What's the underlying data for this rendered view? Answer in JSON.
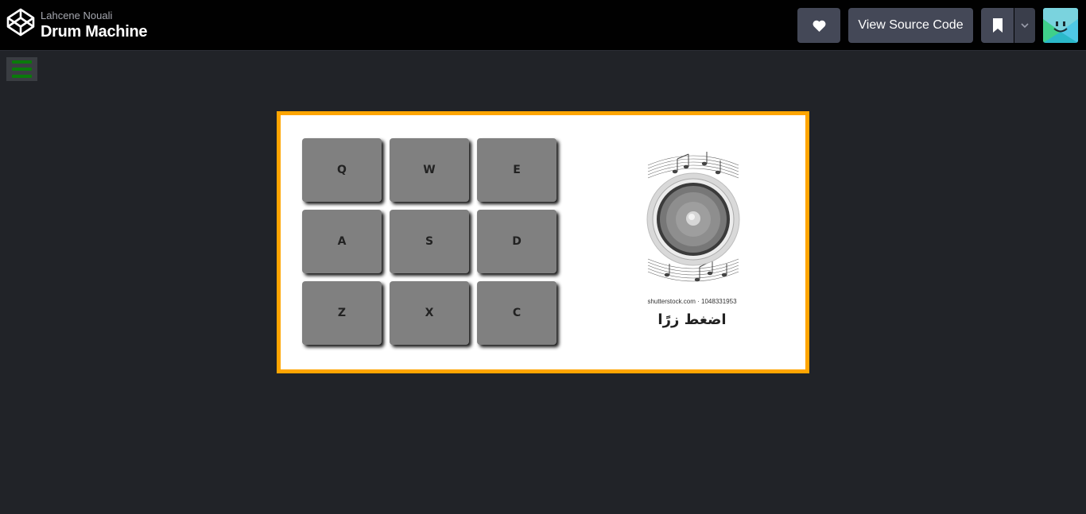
{
  "header": {
    "author": "Lahcene Nouali",
    "title": "Drum Machine",
    "source_label": "View Source Code",
    "logo_icon": "codepen-logo-icon",
    "heart_icon": "heart-icon",
    "bookmark_icon": "bookmark-icon",
    "caret_icon": "chevron-down-icon",
    "avatar_icon": "avatar-smiley"
  },
  "menu": {
    "icon": "hamburger-icon"
  },
  "drum": {
    "pads": [
      "Q",
      "W",
      "E",
      "A",
      "S",
      "D",
      "Z",
      "X",
      "C"
    ],
    "image_credit": "shutterstock.com · 1048331953",
    "display_text": "اضغط زرًا"
  },
  "colors": {
    "page_bg": "#212328",
    "header_bg": "#010101",
    "button_bg": "#444857",
    "machine_border": "#ffa500",
    "pad": "#808080",
    "menu_bars": "#0a7a0a"
  }
}
